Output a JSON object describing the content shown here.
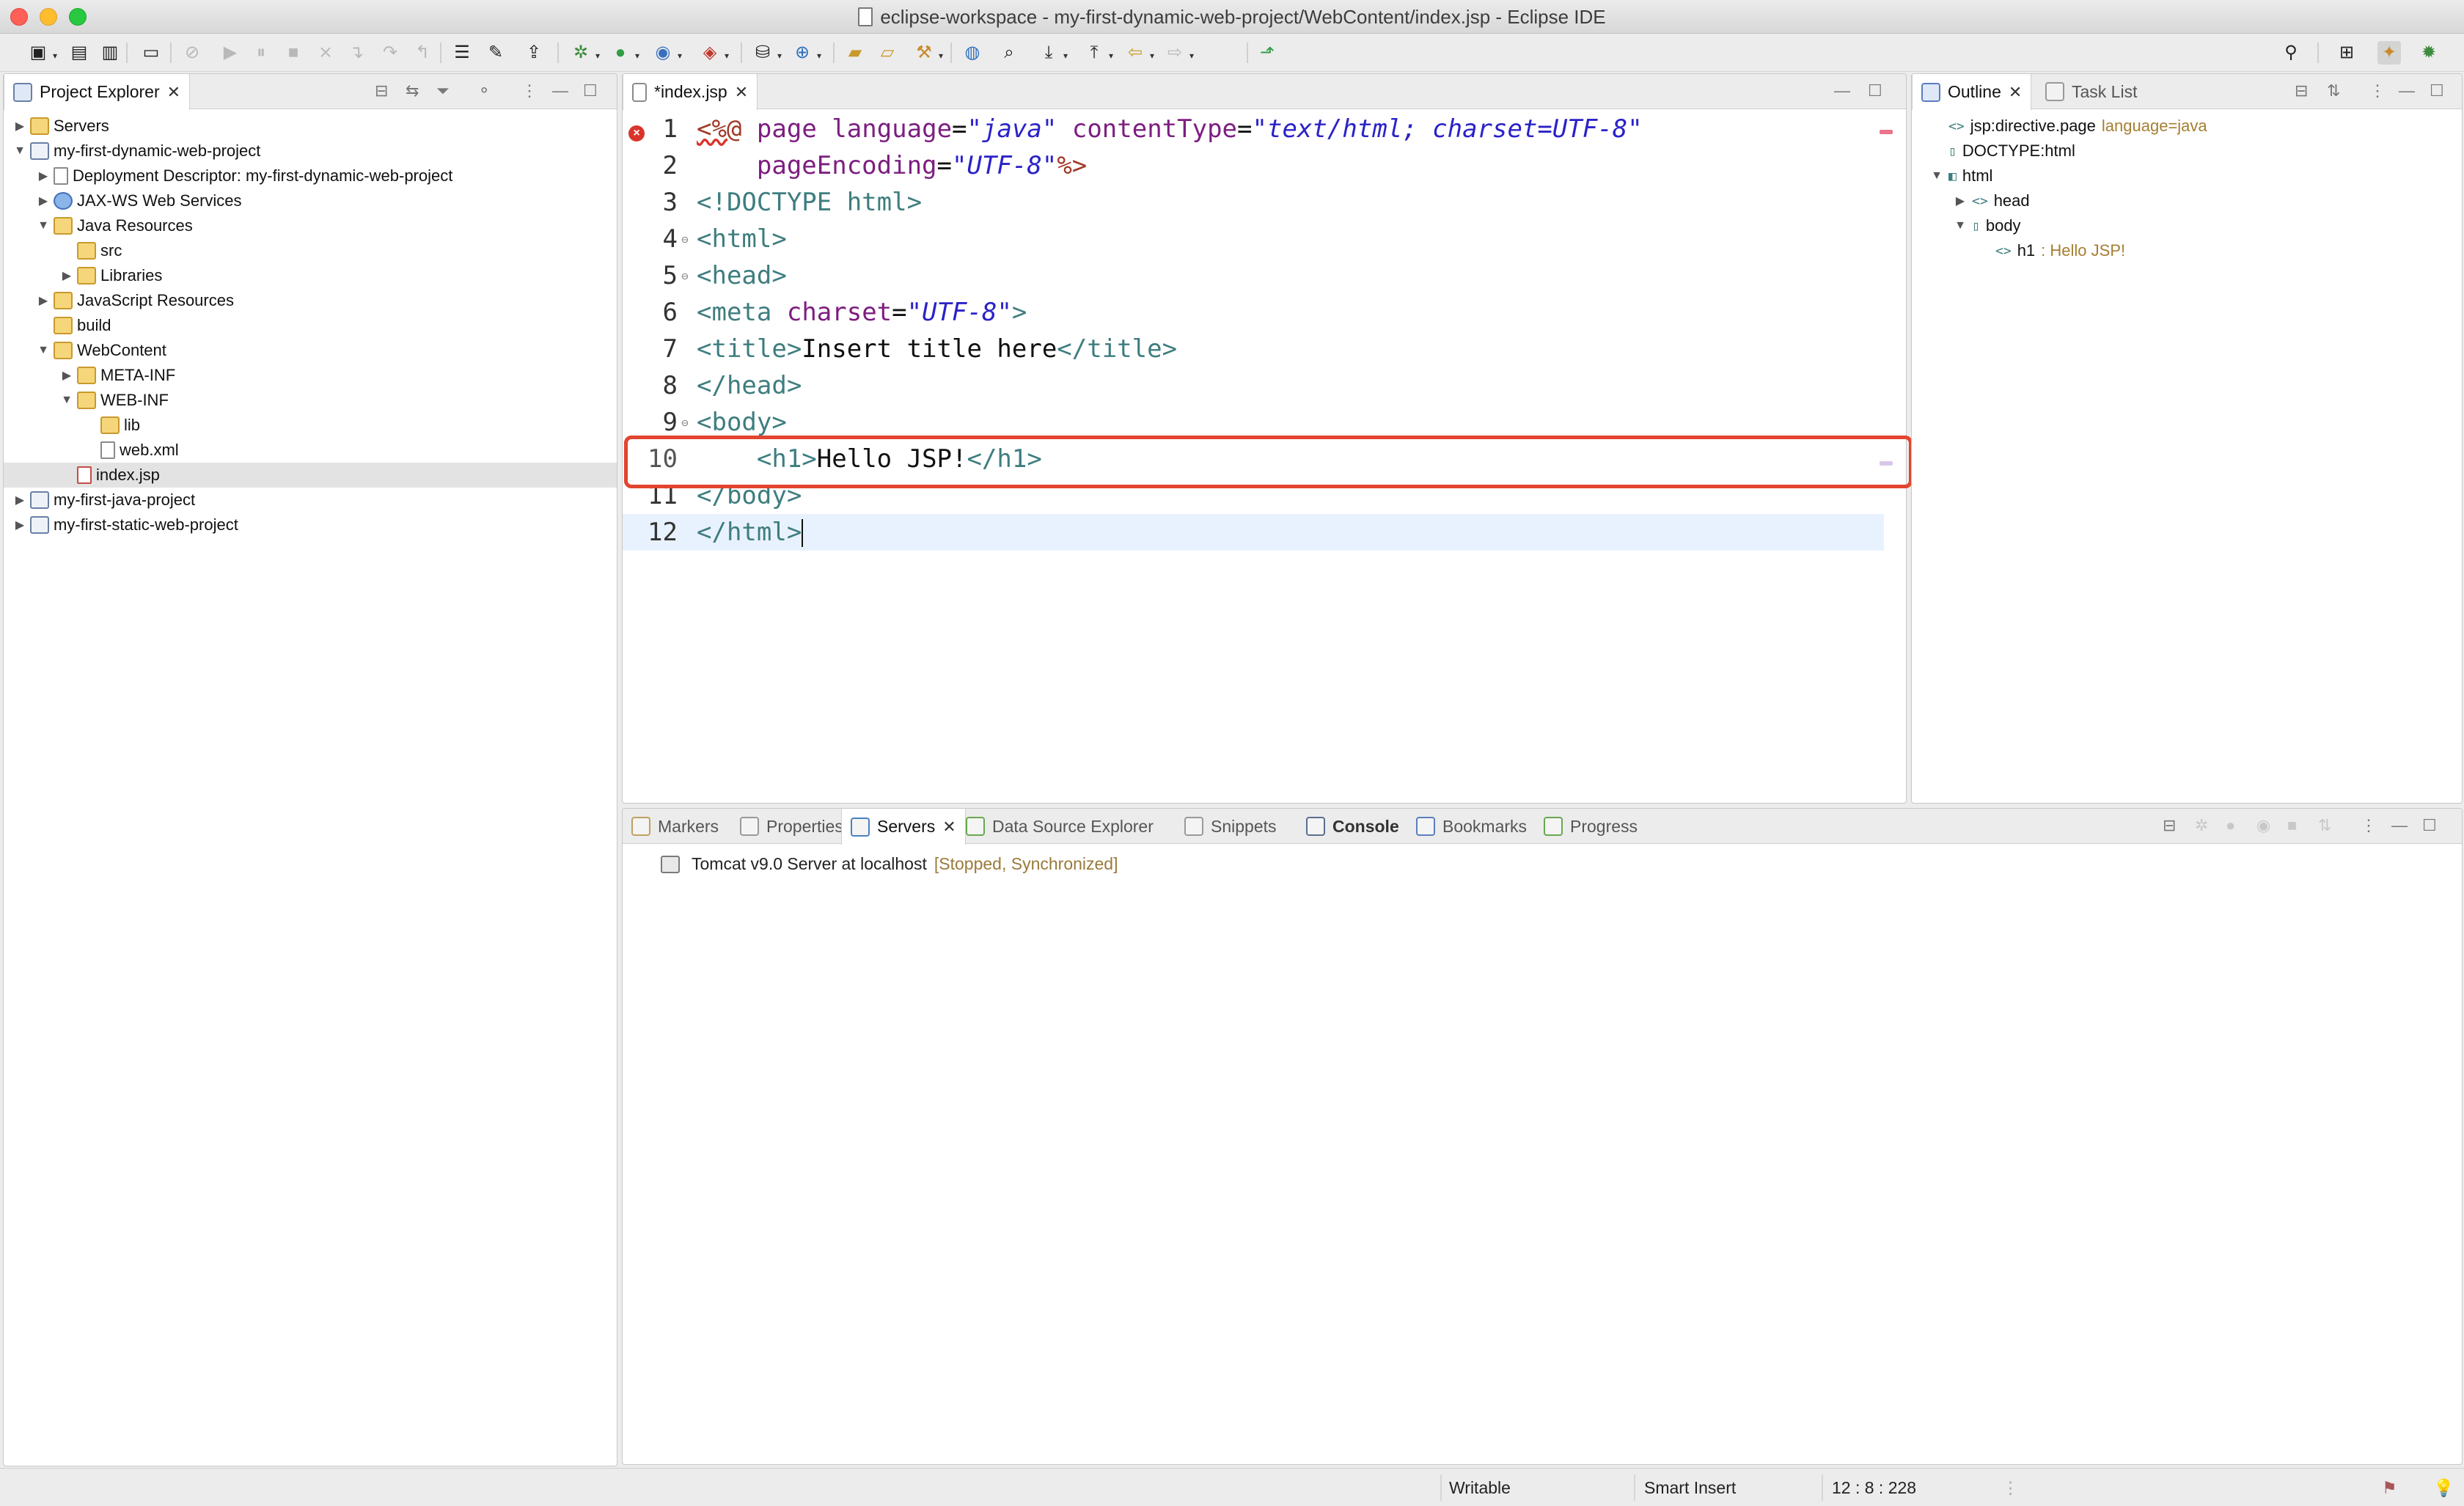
{
  "window": {
    "title": "eclipse-workspace - my-first-dynamic-web-project/WebContent/index.jsp - Eclipse IDE"
  },
  "toolbar": {
    "icons": [
      "new-wizard-icon",
      "save-icon",
      "save-all-icon",
      "terminal-icon",
      "skip-breakpoints-icon",
      "resume-icon",
      "suspend-icon",
      "terminate-icon",
      "disconnect-icon",
      "step-into-icon",
      "step-over-icon",
      "step-return-icon",
      "open-tasks-icon",
      "mark-occurrences-icon",
      "open-type-icon",
      "debug-icon",
      "run-icon",
      "coverage-icon",
      "external-tools-icon",
      "new-server-icon",
      "new-web-icon",
      "open-project-icon",
      "open-folder-icon",
      "refactor-icon",
      "web-browser-icon",
      "search-icon",
      "next-annotation-icon",
      "previous-annotation-icon",
      "back-icon",
      "forward-icon",
      "pin-editor-icon",
      "find-icon",
      "open-perspective-icon",
      "java-ee-perspective-icon",
      "debug-perspective-icon"
    ]
  },
  "project_explorer": {
    "tab_label": "Project Explorer",
    "tree": [
      {
        "label": "Servers",
        "level": 0,
        "twisty": "▶",
        "icon": "server-folder"
      },
      {
        "label": "my-first-dynamic-web-project",
        "level": 0,
        "twisty": "▼",
        "icon": "web-project"
      },
      {
        "label": "Deployment Descriptor: my-first-dynamic-web-project",
        "level": 1,
        "twisty": "▶",
        "icon": "deployment-descriptor"
      },
      {
        "label": "JAX-WS Web Services",
        "level": 1,
        "twisty": "▶",
        "icon": "web-services"
      },
      {
        "label": "Java Resources",
        "level": 1,
        "twisty": "▼",
        "icon": "java-resources"
      },
      {
        "label": "src",
        "level": 2,
        "twisty": "",
        "icon": "source-folder"
      },
      {
        "label": "Libraries",
        "level": 2,
        "twisty": "▶",
        "icon": "libraries"
      },
      {
        "label": "JavaScript Resources",
        "level": 1,
        "twisty": "▶",
        "icon": "javascript-resources"
      },
      {
        "label": "build",
        "level": 1,
        "twisty": "",
        "icon": "folder"
      },
      {
        "label": "WebContent",
        "level": 1,
        "twisty": "▼",
        "icon": "web-content-folder"
      },
      {
        "label": "META-INF",
        "level": 2,
        "twisty": "▶",
        "icon": "folder"
      },
      {
        "label": "WEB-INF",
        "level": 2,
        "twisty": "▼",
        "icon": "folder"
      },
      {
        "label": "lib",
        "level": 3,
        "twisty": "",
        "icon": "folder"
      },
      {
        "label": "web.xml",
        "level": 3,
        "twisty": "",
        "icon": "xml-file"
      },
      {
        "label": "index.jsp",
        "level": 2,
        "twisty": "",
        "icon": "jsp-file",
        "selected": true
      },
      {
        "label": "my-first-java-project",
        "level": 0,
        "twisty": "▶",
        "icon": "java-project"
      },
      {
        "label": "my-first-static-web-project",
        "level": 0,
        "twisty": "▶",
        "icon": "web-project"
      }
    ]
  },
  "editor": {
    "tab_label": "*index.jsp",
    "current_line": 12,
    "highlighted_line": 10,
    "lines": [
      {
        "n": "1",
        "tokens": [
          [
            "jspd",
            "<%@"
          ],
          [
            "txt",
            " "
          ],
          [
            "attr",
            "page"
          ],
          [
            "txt",
            " "
          ],
          [
            "attr",
            "language"
          ],
          [
            "txt",
            "="
          ],
          [
            "val",
            "\"java\""
          ],
          [
            "txt",
            " "
          ],
          [
            "attr",
            "contentType"
          ],
          [
            "txt",
            "="
          ],
          [
            "val",
            "\"text/html; charset=UTF-8\""
          ]
        ]
      },
      {
        "n": "2",
        "tokens": [
          [
            "txt",
            "    "
          ],
          [
            "attr",
            "pageEncoding"
          ],
          [
            "txt",
            "="
          ],
          [
            "val",
            "\"UTF-8\""
          ],
          [
            "jspd2",
            "%>"
          ]
        ]
      },
      {
        "n": "3",
        "tokens": [
          [
            "tag",
            "<!DOCTYPE html>"
          ]
        ]
      },
      {
        "n": "4",
        "fold": true,
        "tokens": [
          [
            "tag",
            "<html>"
          ]
        ]
      },
      {
        "n": "5",
        "fold": true,
        "tokens": [
          [
            "tag",
            "<head>"
          ]
        ]
      },
      {
        "n": "6",
        "tokens": [
          [
            "tag",
            "<meta"
          ],
          [
            "txt",
            " "
          ],
          [
            "attr",
            "charset"
          ],
          [
            "txt",
            "="
          ],
          [
            "val",
            "\"UTF-8\""
          ],
          [
            "tag",
            ">"
          ]
        ]
      },
      {
        "n": "7",
        "tokens": [
          [
            "tag",
            "<title>"
          ],
          [
            "txt",
            "Insert title here"
          ],
          [
            "tag",
            "</title>"
          ]
        ]
      },
      {
        "n": "8",
        "tokens": [
          [
            "tag",
            "</head>"
          ]
        ]
      },
      {
        "n": "9",
        "fold": true,
        "tokens": [
          [
            "tag",
            "<body>"
          ]
        ]
      },
      {
        "n": "10",
        "tokens": [
          [
            "txt",
            "    "
          ],
          [
            "tag",
            "<h1>"
          ],
          [
            "txt",
            "Hello JSP!"
          ],
          [
            "tag",
            "</h1>"
          ]
        ]
      },
      {
        "n": "11",
        "tokens": [
          [
            "tag",
            "</body>"
          ]
        ]
      },
      {
        "n": "12",
        "tokens": [
          [
            "tag",
            "</html>"
          ]
        ],
        "caret": true
      }
    ]
  },
  "outline": {
    "tab_label": "Outline",
    "task_list_label": "Task List",
    "tree": [
      {
        "label": "jsp:directive.page",
        "extra": "language=java",
        "level": 0,
        "twisty": "",
        "icon": "<>"
      },
      {
        "label": "DOCTYPE:html",
        "extra": "",
        "level": 0,
        "twisty": "",
        "icon": "▯"
      },
      {
        "label": "html",
        "extra": "",
        "level": 0,
        "twisty": "▼",
        "icon": "◧"
      },
      {
        "label": "head",
        "extra": "",
        "level": 1,
        "twisty": "▶",
        "icon": "<>"
      },
      {
        "label": "body",
        "extra": "",
        "level": 1,
        "twisty": "▼",
        "icon": "▯"
      },
      {
        "label": "h1",
        "extra": ": Hello JSP!",
        "level": 2,
        "twisty": "",
        "icon": "<>"
      }
    ]
  },
  "bottom_panel": {
    "tabs": [
      {
        "label": "Markers",
        "active": false
      },
      {
        "label": "Properties",
        "active": false
      },
      {
        "label": "Servers",
        "active": true
      },
      {
        "label": "Data Source Explorer",
        "active": false
      },
      {
        "label": "Snippets",
        "active": false
      },
      {
        "label": "Console",
        "active": false,
        "bold": true
      },
      {
        "label": "Bookmarks",
        "active": false
      },
      {
        "label": "Progress",
        "active": false
      }
    ],
    "server": {
      "name": "Tomcat v9.0 Server at localhost",
      "state": "[Stopped, Synchronized]"
    }
  },
  "status_bar": {
    "writable": "Writable",
    "insert_mode": "Smart Insert",
    "position": "12 : 8 : 228"
  },
  "colors": {
    "highlight_box": "#e2452f",
    "tag": "#3e7d7f",
    "attribute": "#7d1e80",
    "value": "#2a22c8",
    "current_line": "#e8f2fe"
  }
}
